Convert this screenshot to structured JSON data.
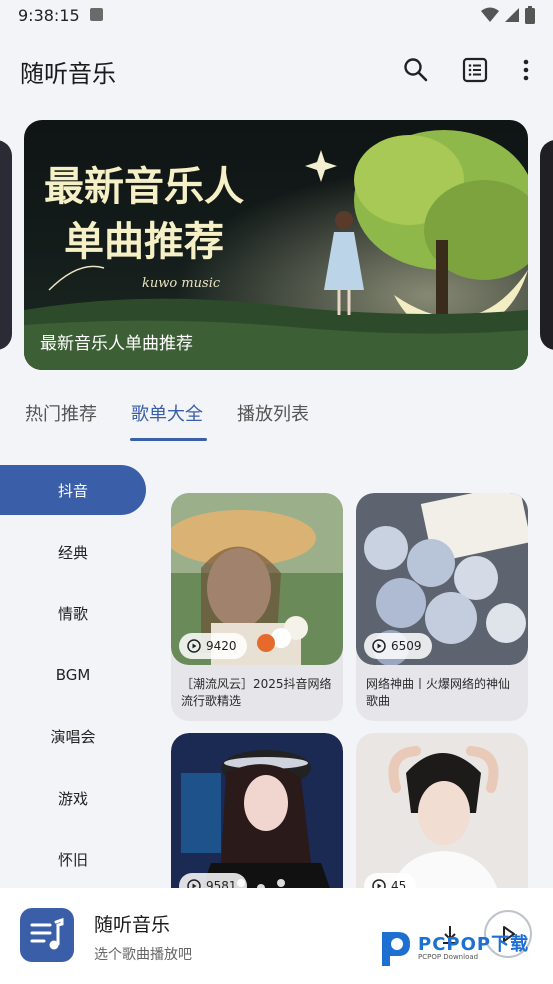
{
  "status": {
    "time": "9:38:15"
  },
  "app_bar": {
    "title": "随听音乐",
    "icons": [
      "search-icon",
      "list-icon",
      "more-vert-icon"
    ]
  },
  "banner": {
    "caption": "最新音乐人单曲推荐",
    "art_title_line1": "最新音乐人",
    "art_title_line2": "单曲推荐",
    "art_sub": "kuwo music"
  },
  "tabs": [
    {
      "label": "热门推荐"
    },
    {
      "label": "歌单大全",
      "active": true
    },
    {
      "label": "播放列表"
    }
  ],
  "sidebar": {
    "items": [
      "抖音",
      "经典",
      "情歌",
      "BGM",
      "演唱会",
      "游戏",
      "怀旧"
    ],
    "active_index": 0
  },
  "playlists": [
    {
      "plays": "9420",
      "title": "［潮流风云］2025抖音网络流行歌精选"
    },
    {
      "plays": "6509",
      "title": "网络神曲丨火爆网络的神仙歌曲"
    },
    {
      "plays": "9581",
      "title": ""
    },
    {
      "plays": "45",
      "title": ""
    }
  ],
  "player": {
    "title": "随听音乐",
    "subtitle": "选个歌曲播放吧"
  },
  "watermark": {
    "text": "PCPOP下载",
    "sub": "PCPOP Download"
  },
  "colors": {
    "accent": "#3a5fa8",
    "background": "#f3f4f8"
  }
}
